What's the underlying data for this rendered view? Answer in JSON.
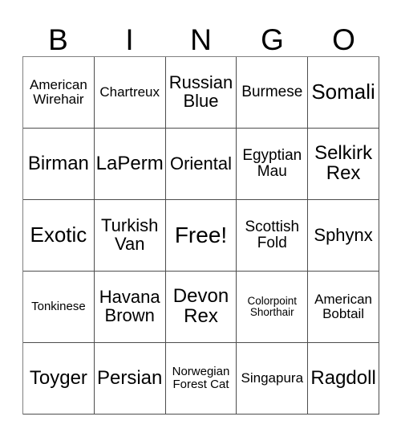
{
  "card": {
    "title_letters": [
      "B",
      "I",
      "N",
      "G",
      "O"
    ],
    "border_color": "#808080",
    "cell_border_color": "#4d4d4d",
    "background_color": "#ffffff",
    "text_color": "#000000",
    "free_space": "Free!",
    "rows": [
      [
        {
          "text": "American Wirehair",
          "size": "fs-md"
        },
        {
          "text": "Chartreux",
          "size": "fs-md"
        },
        {
          "text": "Russian Blue",
          "size": "fs-xl"
        },
        {
          "text": "Burmese",
          "size": "fs-lg"
        },
        {
          "text": "Somali",
          "size": "fs-3xl"
        }
      ],
      [
        {
          "text": "Birman",
          "size": "fs-2xl"
        },
        {
          "text": "LaPerm",
          "size": "fs-2xl"
        },
        {
          "text": "Oriental",
          "size": "fs-xl"
        },
        {
          "text": "Egyptian Mau",
          "size": "fs-lg"
        },
        {
          "text": "Selkirk Rex",
          "size": "fs-2xl"
        }
      ],
      [
        {
          "text": "Exotic",
          "size": "fs-3xl"
        },
        {
          "text": "Turkish Van",
          "size": "fs-xl"
        },
        {
          "text": "Free!",
          "size": "fs-4xl"
        },
        {
          "text": "Scottish Fold",
          "size": "fs-lg"
        },
        {
          "text": "Sphynx",
          "size": "fs-xl"
        }
      ],
      [
        {
          "text": "Tonkinese",
          "size": "fs-sm"
        },
        {
          "text": "Havana Brown",
          "size": "fs-xl"
        },
        {
          "text": "Devon Rex",
          "size": "fs-2xl"
        },
        {
          "text": "Colorpoint Shorthair",
          "size": "fs-xs"
        },
        {
          "text": "American Bobtail",
          "size": "fs-md"
        }
      ],
      [
        {
          "text": "Toyger",
          "size": "fs-2xl"
        },
        {
          "text": "Persian",
          "size": "fs-2xl"
        },
        {
          "text": "Norwegian Forest Cat",
          "size": "fs-sm"
        },
        {
          "text": "Singapura",
          "size": "fs-md"
        },
        {
          "text": "Ragdoll",
          "size": "fs-2xl"
        }
      ]
    ]
  }
}
